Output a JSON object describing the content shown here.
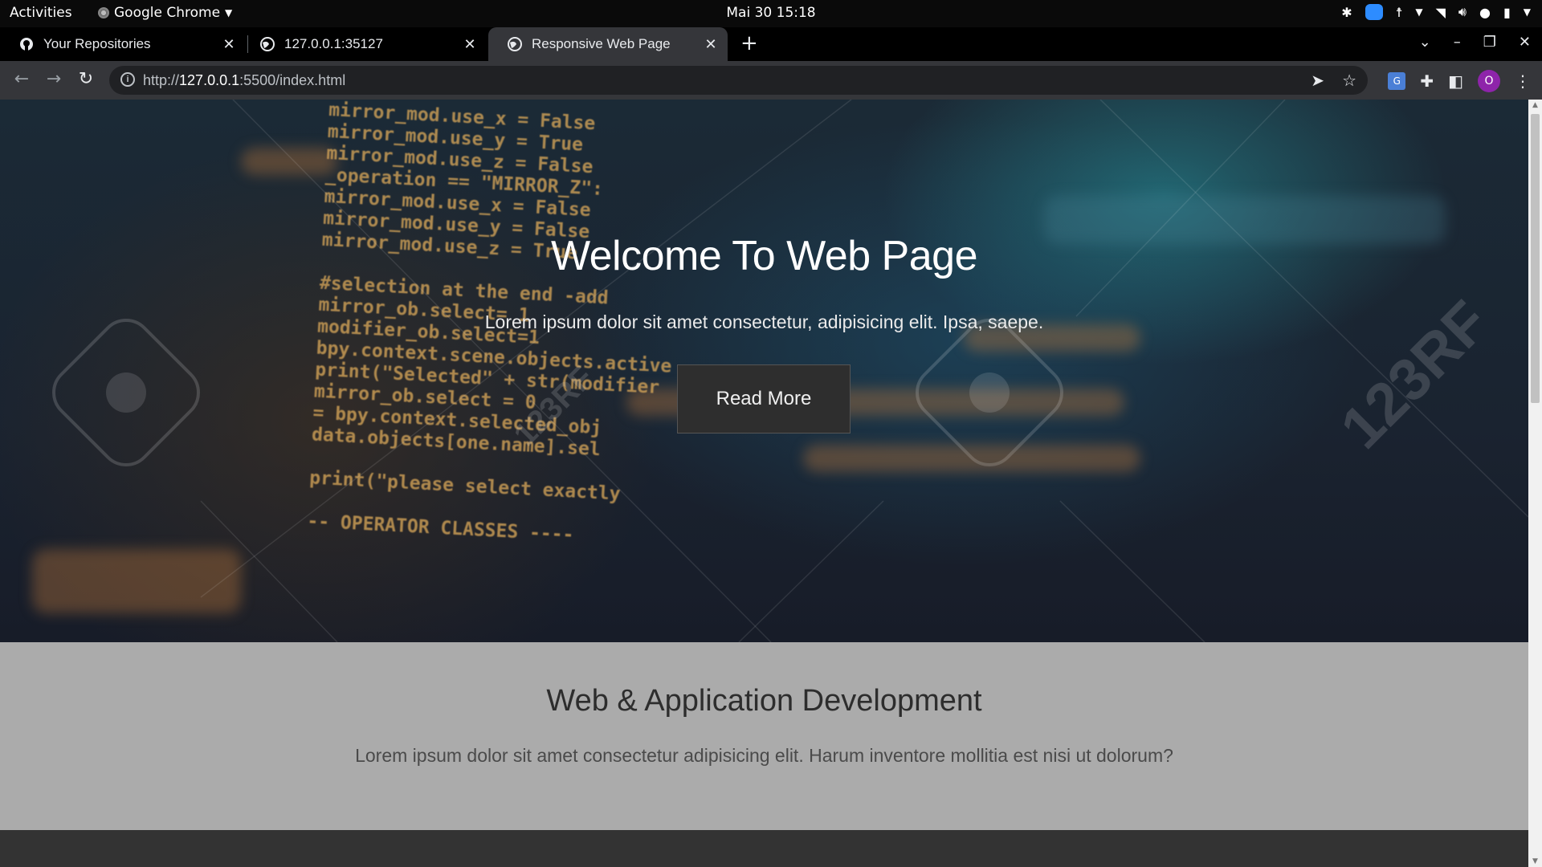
{
  "system": {
    "activities": "Activities",
    "app_name": "Google Chrome",
    "clock": "Mai 30  15:18"
  },
  "browser": {
    "tabs": [
      {
        "title": "Your Repositories",
        "icon": "github-icon",
        "active": false
      },
      {
        "title": "127.0.0.1:35127",
        "icon": "globe-icon",
        "active": false
      },
      {
        "title": "Responsive Web Page",
        "icon": "globe-icon",
        "active": true
      }
    ],
    "url_prefix": "http://",
    "url_host": "127.0.0.1",
    "url_path": ":5500/index.html",
    "profile_initial": "O",
    "translate_label": "G"
  },
  "hero": {
    "title": "Welcome To Web Page",
    "text": "Lorem ipsum dolor sit amet consectetur, adipisicing elit. Ipsa, saepe.",
    "button_label": "Read More",
    "watermark_text": "123RF",
    "code_lines": [
      "mirror_mod.use_x = False",
      "mirror_mod.use_y = True",
      "mirror_mod.use_z = False",
      "_operation == \"MIRROR_Z\":",
      "mirror_mod.use_x = False",
      "mirror_mod.use_y = False",
      "mirror_mod.use_z = True",
      "",
      "#selection at the end -add",
      "mirror_ob.select= 1",
      "modifier_ob.select=1",
      "bpy.context.scene.objects.active",
      "print(\"Selected\" + str(modifier",
      "mirror_ob.select = 0",
      "= bpy.context.selected_obj",
      "data.objects[one.name].sel",
      "",
      "print(\"please select exactly",
      "",
      "-- OPERATOR CLASSES ----"
    ]
  },
  "section": {
    "title": "Web & Application Development",
    "text": "Lorem ipsum dolor sit amet consectetur adipisicing elit. Harum inventore mollitia est nisi ut dolorum?"
  },
  "colors": {
    "hero_button_bg": "#2e2e2e",
    "section_bg": "#ababab",
    "footer_bg": "#333333",
    "tab_active_bg": "#35363a"
  }
}
